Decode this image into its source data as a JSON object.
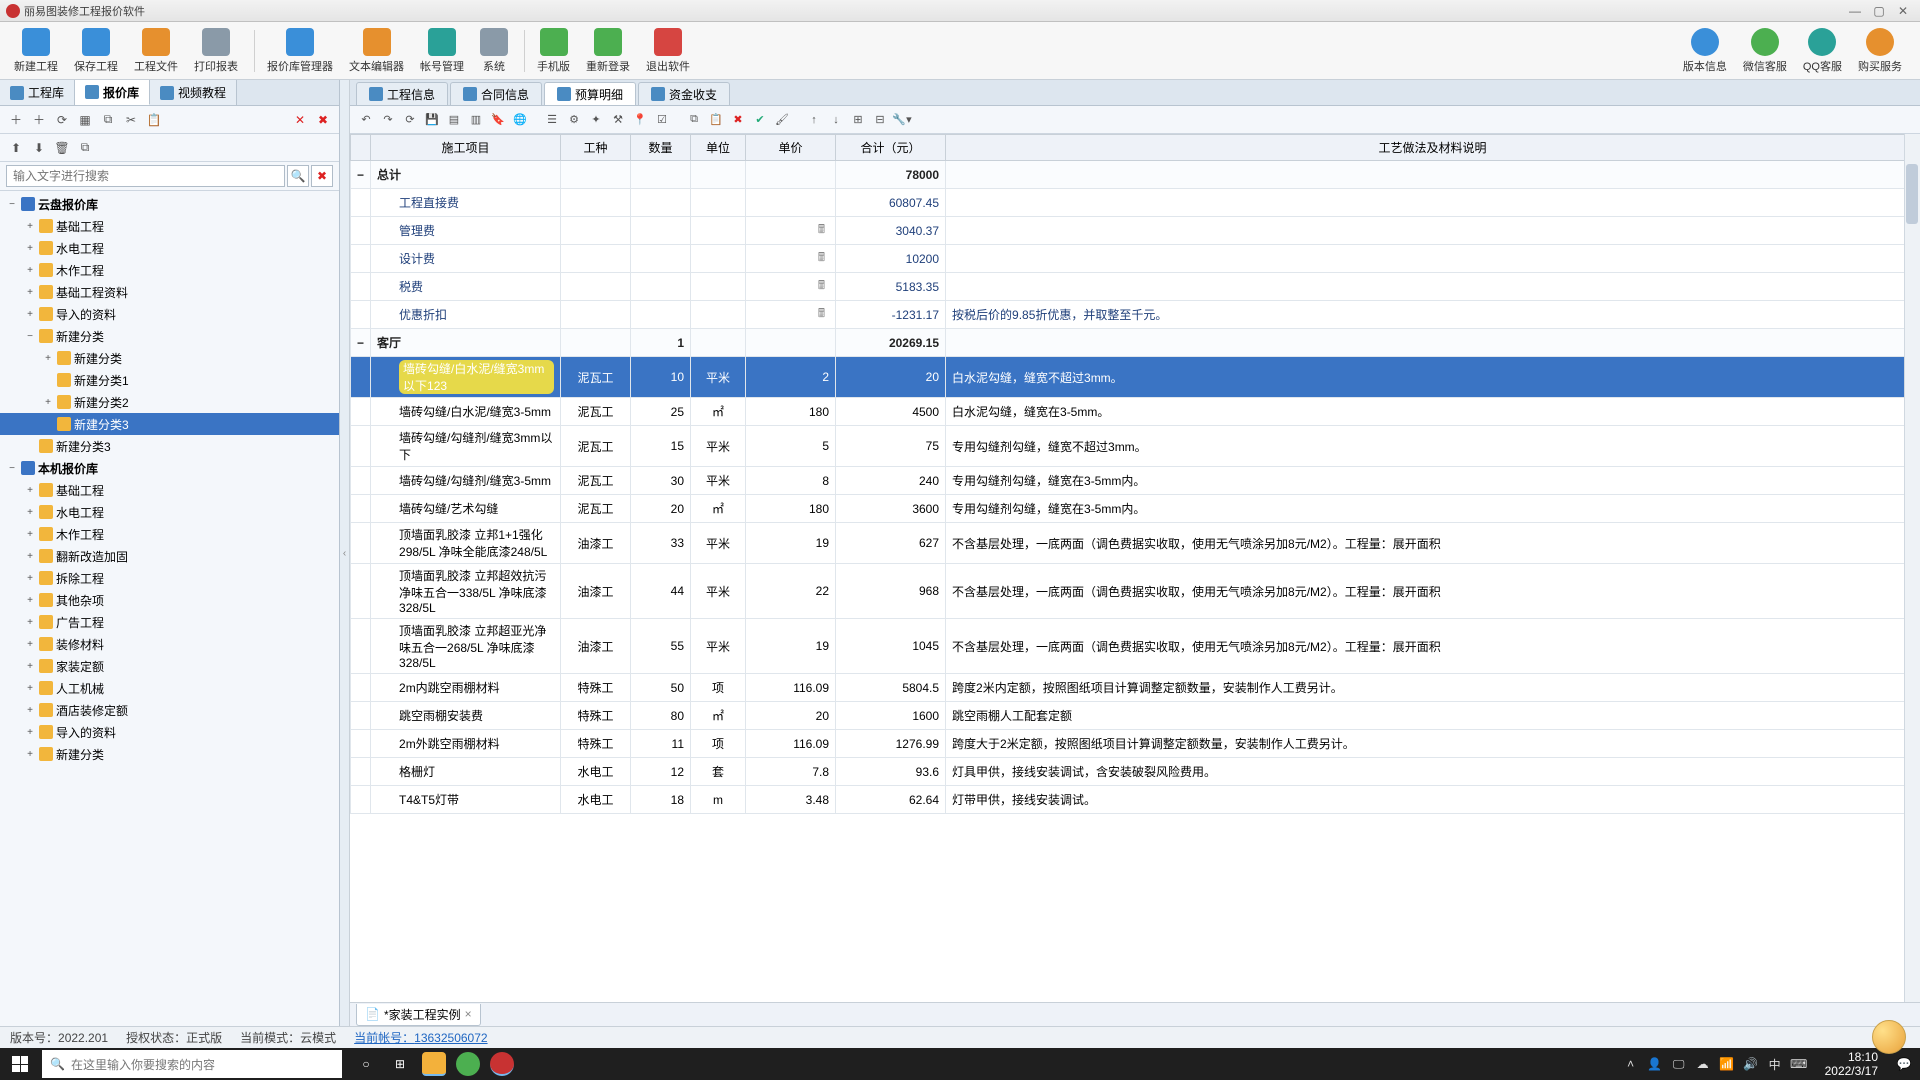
{
  "window_title": "丽易图装修工程报价软件",
  "toolbar": [
    {
      "label": "新建工程",
      "color": "ic-blue"
    },
    {
      "label": "保存工程",
      "color": "ic-blue"
    },
    {
      "label": "工程文件",
      "color": "ic-orange"
    },
    {
      "label": "打印报表",
      "color": "ic-gray"
    },
    {
      "sep": true
    },
    {
      "label": "报价库管理器",
      "color": "ic-blue"
    },
    {
      "label": "文本编辑器",
      "color": "ic-orange"
    },
    {
      "label": "帐号管理",
      "color": "ic-teal"
    },
    {
      "label": "系统",
      "color": "ic-gray"
    },
    {
      "sep": true
    },
    {
      "label": "手机版",
      "color": "ic-green"
    },
    {
      "label": "重新登录",
      "color": "ic-green"
    },
    {
      "label": "退出软件",
      "color": "ic-red"
    }
  ],
  "toolbar_right": [
    {
      "label": "版本信息",
      "color": "ic-blue"
    },
    {
      "label": "微信客服",
      "color": "ic-green"
    },
    {
      "label": "QQ客服",
      "color": "ic-teal"
    },
    {
      "label": "购买服务",
      "color": "ic-orange"
    }
  ],
  "left_tabs": [
    {
      "label": "工程库",
      "active": false
    },
    {
      "label": "报价库",
      "active": true
    },
    {
      "label": "视频教程",
      "active": false
    }
  ],
  "search_placeholder": "输入文字进行搜索",
  "tree": [
    {
      "depth": 0,
      "exp": "−",
      "ico": "root",
      "label": "云盘报价库"
    },
    {
      "depth": 1,
      "exp": "+",
      "ico": "folder",
      "label": "基础工程"
    },
    {
      "depth": 1,
      "exp": "+",
      "ico": "folder",
      "label": "水电工程"
    },
    {
      "depth": 1,
      "exp": "+",
      "ico": "folder",
      "label": "木作工程"
    },
    {
      "depth": 1,
      "exp": "+",
      "ico": "folder",
      "label": "基础工程资料"
    },
    {
      "depth": 1,
      "exp": "+",
      "ico": "folder",
      "label": "导入的资料"
    },
    {
      "depth": 1,
      "exp": "−",
      "ico": "folder",
      "label": "新建分类"
    },
    {
      "depth": 2,
      "exp": "+",
      "ico": "folder",
      "label": "新建分类"
    },
    {
      "depth": 2,
      "exp": "",
      "ico": "folder",
      "label": "新建分类1"
    },
    {
      "depth": 2,
      "exp": "+",
      "ico": "folder",
      "label": "新建分类2"
    },
    {
      "depth": 2,
      "exp": "",
      "ico": "folder",
      "label": "新建分类3",
      "selected": true
    },
    {
      "depth": 1,
      "exp": "",
      "ico": "folder",
      "label": "新建分类3"
    },
    {
      "depth": 0,
      "exp": "−",
      "ico": "root",
      "label": "本机报价库"
    },
    {
      "depth": 1,
      "exp": "+",
      "ico": "folder",
      "label": "基础工程"
    },
    {
      "depth": 1,
      "exp": "+",
      "ico": "folder",
      "label": "水电工程"
    },
    {
      "depth": 1,
      "exp": "+",
      "ico": "folder",
      "label": "木作工程"
    },
    {
      "depth": 1,
      "exp": "+",
      "ico": "folder",
      "label": "翻新改造加固"
    },
    {
      "depth": 1,
      "exp": "+",
      "ico": "folder",
      "label": "拆除工程"
    },
    {
      "depth": 1,
      "exp": "+",
      "ico": "folder",
      "label": "其他杂项"
    },
    {
      "depth": 1,
      "exp": "+",
      "ico": "folder",
      "label": "广告工程"
    },
    {
      "depth": 1,
      "exp": "+",
      "ico": "folder",
      "label": "装修材料"
    },
    {
      "depth": 1,
      "exp": "+",
      "ico": "folder",
      "label": "家装定额"
    },
    {
      "depth": 1,
      "exp": "+",
      "ico": "folder",
      "label": "人工机械"
    },
    {
      "depth": 1,
      "exp": "+",
      "ico": "folder",
      "label": "酒店装修定额"
    },
    {
      "depth": 1,
      "exp": "+",
      "ico": "folder",
      "label": "导入的资料"
    },
    {
      "depth": 1,
      "exp": "+",
      "ico": "folder",
      "label": "新建分类"
    }
  ],
  "doc_tabs": [
    {
      "label": "工程信息"
    },
    {
      "label": "合同信息"
    },
    {
      "label": "预算明细",
      "active": true
    },
    {
      "label": "资金收支"
    }
  ],
  "cols": {
    "item": "施工项目",
    "kind": "工种",
    "qty": "数量",
    "unit": "单位",
    "price": "单价",
    "sum": "合计（元）",
    "desc": "工艺做法及材料说明"
  },
  "rows": [
    {
      "type": "hdr",
      "exp": "−",
      "item": "总计",
      "sum": "78000"
    },
    {
      "type": "sub",
      "item": "工程直接费",
      "sum": "60807.45"
    },
    {
      "type": "sub",
      "item": "管理费",
      "calc": true,
      "sum": "3040.37"
    },
    {
      "type": "sub",
      "item": "设计费",
      "calc": true,
      "sum": "10200"
    },
    {
      "type": "sub",
      "item": "税费",
      "calc": true,
      "sum": "5183.35"
    },
    {
      "type": "sub",
      "item": "优惠折扣",
      "calc": true,
      "sum": "-1231.17",
      "neg": true,
      "desc": "按税后价的9.85折优惠，并取整至千元。"
    },
    {
      "type": "hdr",
      "exp": "−",
      "item": "客厅",
      "qty": "1",
      "sum": "20269.15"
    },
    {
      "type": "sel",
      "item": "墙砖勾缝/白水泥/缝宽3mm以下123",
      "kind": "泥瓦工",
      "qty": "10",
      "unit": "平米",
      "price": "2",
      "sum": "20",
      "desc": "白水泥勾缝，缝宽不超过3mm。",
      "hl": true
    },
    {
      "item": "墙砖勾缝/白水泥/缝宽3-5mm",
      "kind": "泥瓦工",
      "qty": "25",
      "unit": "㎡",
      "price": "180",
      "sum": "4500",
      "desc": "白水泥勾缝，缝宽在3-5mm。"
    },
    {
      "item": "墙砖勾缝/勾缝剂/缝宽3mm以下",
      "kind": "泥瓦工",
      "qty": "15",
      "unit": "平米",
      "price": "5",
      "sum": "75",
      "desc": "专用勾缝剂勾缝，缝宽不超过3mm。"
    },
    {
      "item": "墙砖勾缝/勾缝剂/缝宽3-5mm",
      "kind": "泥瓦工",
      "qty": "30",
      "unit": "平米",
      "price": "8",
      "sum": "240",
      "desc": "专用勾缝剂勾缝，缝宽在3-5mm内。"
    },
    {
      "item": "墙砖勾缝/艺术勾缝",
      "kind": "泥瓦工",
      "qty": "20",
      "unit": "㎡",
      "price": "180",
      "sum": "3600",
      "desc": "专用勾缝剂勾缝，缝宽在3-5mm内。"
    },
    {
      "item": "顶墙面乳胶漆 立邦1+1强化298/5L 净味全能底漆248/5L",
      "kind": "油漆工",
      "qty": "33",
      "unit": "平米",
      "price": "19",
      "sum": "627",
      "desc": "不含基层处理，一底两面（调色费据实收取，使用无气喷涂另加8元/M2）。工程量：展开面积"
    },
    {
      "item": "顶墙面乳胶漆 立邦超效抗污净味五合一338/5L 净味底漆328/5L",
      "kind": "油漆工",
      "qty": "44",
      "unit": "平米",
      "price": "22",
      "sum": "968",
      "desc": "不含基层处理，一底两面（调色费据实收取，使用无气喷涂另加8元/M2）。工程量：展开面积"
    },
    {
      "item": "顶墙面乳胶漆 立邦超亚光净味五合一268/5L 净味底漆328/5L",
      "kind": "油漆工",
      "qty": "55",
      "unit": "平米",
      "price": "19",
      "sum": "1045",
      "desc": "不含基层处理，一底两面（调色费据实收取，使用无气喷涂另加8元/M2）。工程量：展开面积"
    },
    {
      "item": "2m内跳空雨棚材料",
      "kind": "特殊工",
      "qty": "50",
      "unit": "项",
      "price": "116.09",
      "sum": "5804.5",
      "desc": "跨度2米内定额，按照图纸项目计算调整定额数量，安装制作人工费另计。"
    },
    {
      "item": "跳空雨棚安装费",
      "kind": "特殊工",
      "qty": "80",
      "unit": "㎡",
      "price": "20",
      "sum": "1600",
      "desc": "跳空雨棚人工配套定额"
    },
    {
      "item": "2m外跳空雨棚材料",
      "kind": "特殊工",
      "qty": "11",
      "unit": "项",
      "price": "116.09",
      "sum": "1276.99",
      "desc": "跨度大于2米定额，按照图纸项目计算调整定额数量，安装制作人工费另计。"
    },
    {
      "item": "格栅灯",
      "kind": "水电工",
      "qty": "12",
      "unit": "套",
      "price": "7.8",
      "sum": "93.6",
      "desc": "灯具甲供，接线安装调试，含安装破裂风险费用。"
    },
    {
      "item": "T4&T5灯带",
      "kind": "水电工",
      "qty": "18",
      "unit": "m",
      "price": "3.48",
      "sum": "62.64",
      "desc": "灯带甲供，接线安装调试。"
    }
  ],
  "bottom_tab": "*家装工程实例",
  "status": {
    "version_label": "版本号：",
    "version": "2022.201",
    "auth_label": "授权状态：",
    "auth": "正式版",
    "mode_label": "当前模式：",
    "mode": "云模式",
    "acct_label": "当前帐号：",
    "acct": "13632506072"
  },
  "taskbar": {
    "search_placeholder": "在这里输入你要搜索的内容",
    "time": "18:10",
    "date": "2022/3/17"
  }
}
